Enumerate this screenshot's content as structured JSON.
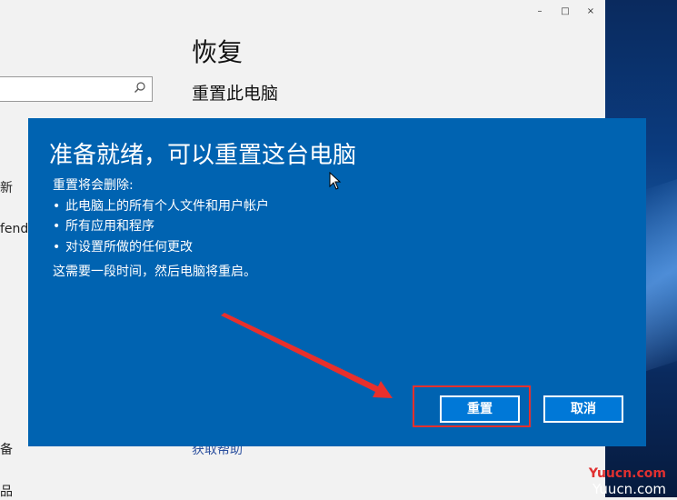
{
  "settings": {
    "page_title": "恢复",
    "section_title": "重置此电脑",
    "help_link": "获取帮助",
    "left_fragments": [
      "新",
      "fende",
      "备",
      "品"
    ]
  },
  "dialog": {
    "title": "准备就绪，可以重置这台电脑",
    "intro": "重置将会删除:",
    "items": [
      "此电脑上的所有个人文件和用户帐户",
      "所有应用和程序",
      "对设置所做的任何更改"
    ],
    "note": "这需要一段时间，然后电脑将重启。",
    "reset_button": "重置",
    "cancel_button": "取消"
  },
  "watermark": {
    "top": "Yuucn.com",
    "bottom": "Yuucn.com"
  },
  "colors": {
    "dialog_bg": "#0063b1",
    "button_bg": "#0078d7",
    "highlight": "#e8302c"
  }
}
